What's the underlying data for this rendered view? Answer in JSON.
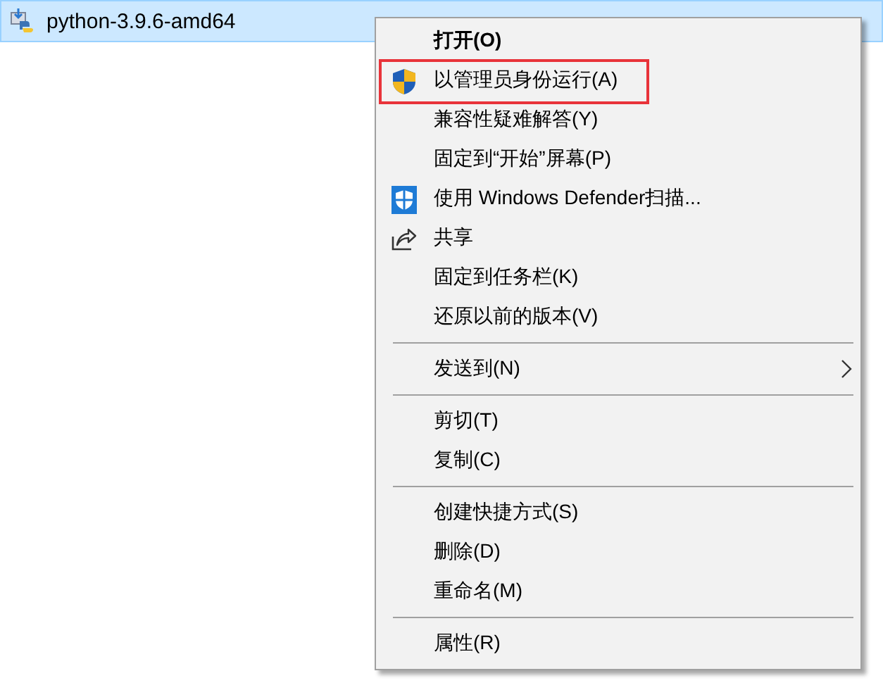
{
  "file": {
    "name": "python-3.9.6-amd64",
    "selected": true
  },
  "context_menu": {
    "items": [
      {
        "kind": "item",
        "label": "打开(O)",
        "bold": true
      },
      {
        "kind": "item",
        "label": "以管理员身份运行(A)",
        "annotated": true
      },
      {
        "kind": "item",
        "label": "兼容性疑难解答(Y)"
      },
      {
        "kind": "item",
        "label": "固定到“开始”屏幕(P)"
      },
      {
        "kind": "item",
        "label": "使用 Windows Defender扫描..."
      },
      {
        "kind": "item",
        "label": "共享"
      },
      {
        "kind": "item",
        "label": "固定到任务栏(K)"
      },
      {
        "kind": "item",
        "label": "还原以前的版本(V)"
      },
      {
        "kind": "separator"
      },
      {
        "kind": "item",
        "label": "发送到(N)",
        "submenu": true
      },
      {
        "kind": "separator"
      },
      {
        "kind": "item",
        "label": "剪切(T)"
      },
      {
        "kind": "item",
        "label": "复制(C)"
      },
      {
        "kind": "separator"
      },
      {
        "kind": "item",
        "label": "创建快捷方式(S)"
      },
      {
        "kind": "item",
        "label": "删除(D)"
      },
      {
        "kind": "item",
        "label": "重命名(M)"
      },
      {
        "kind": "separator"
      },
      {
        "kind": "item",
        "label": "属性(R)"
      }
    ]
  }
}
